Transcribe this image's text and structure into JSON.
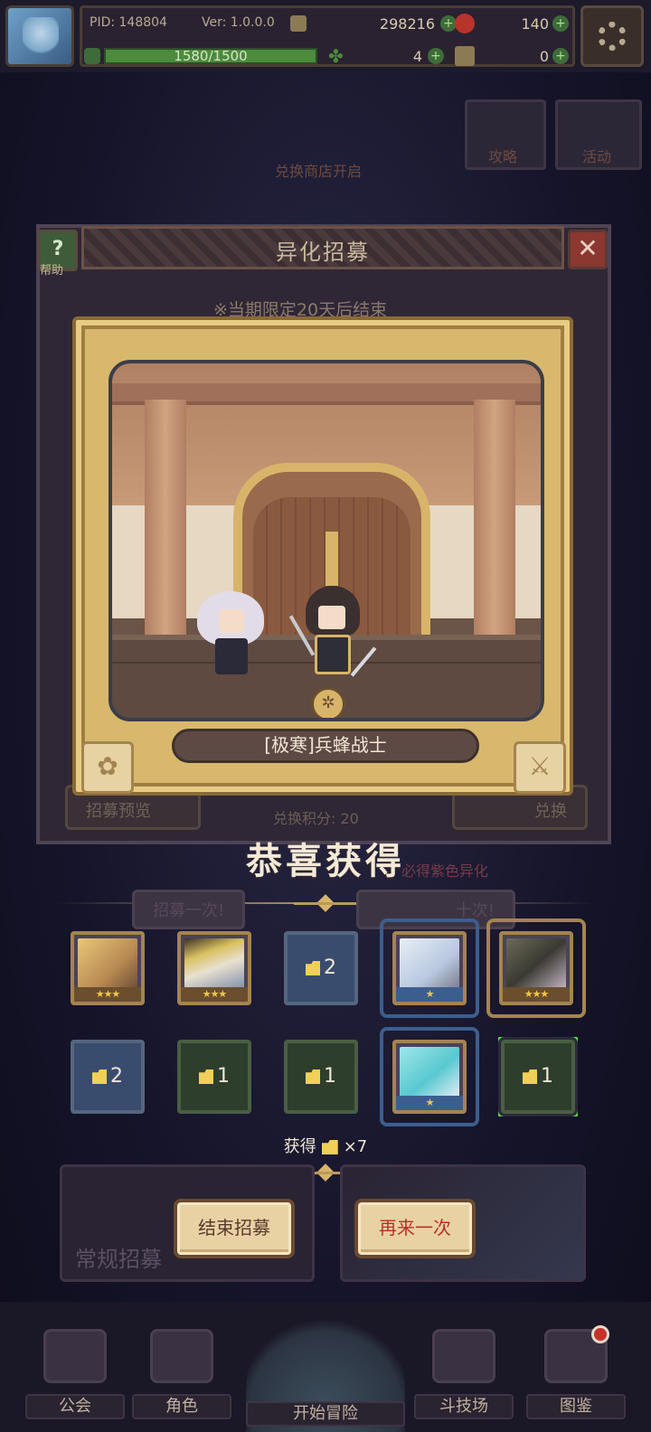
{
  "header": {
    "pid": "PID: 148804",
    "version": "Ver: 1.0.0.0",
    "gold": "298216",
    "gems": "140",
    "stamina_text": "1580/1500",
    "stamina_fill": 1.0,
    "clover": "4",
    "keys": "0"
  },
  "background": {
    "exchange_shop": "兑换商店开启",
    "guide": "攻略",
    "event": "活动",
    "recruit_preview": "招募预览",
    "exchange": "兑换",
    "exchange_points": "兑换积分: 20",
    "purple_note": "必得紫色异化",
    "recruit_once": "招募一次!",
    "recruit_ten": "十次!",
    "regular_recruit": "常规招募"
  },
  "recruit_window": {
    "title": "异化招募",
    "help": "帮助",
    "limit": "※当期限定20天后结束"
  },
  "card": {
    "name": "[极寒]兵蜂战士"
  },
  "congrats": "恭喜获得",
  "rewards_row1": [
    {
      "type": "hero",
      "stars": "★★★"
    },
    {
      "type": "hero",
      "stars": "★★★"
    },
    {
      "type": "fragment",
      "count": "2"
    },
    {
      "type": "hero",
      "stars": "★"
    },
    {
      "type": "hero",
      "stars": "★★★"
    }
  ],
  "rewards_row2": [
    {
      "type": "fragment",
      "count": "2"
    },
    {
      "type": "fragment",
      "count": "1"
    },
    {
      "type": "fragment",
      "count": "1"
    },
    {
      "type": "hero",
      "stars": "★"
    },
    {
      "type": "fragment",
      "count": "1"
    }
  ],
  "obtained": {
    "label": "获得",
    "count": "×7"
  },
  "buttons": {
    "end": "结束招募",
    "again": "再来一次"
  },
  "nav": {
    "guild": "公会",
    "character": "角色",
    "adventure": "开始冒险",
    "arena": "斗技场",
    "codex": "图鉴"
  },
  "colors": {
    "gold_frame": "#d8b46a",
    "again_text": "#b8302a",
    "rarity_blue": "#3c5e8e",
    "rarity_gold": "#a48450",
    "highlight_green": "#5ed84e"
  }
}
